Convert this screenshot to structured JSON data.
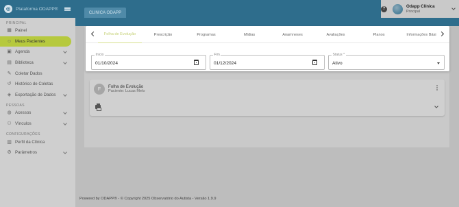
{
  "sidebar": {
    "app_title": "Plataforma ODAPP®",
    "logo_glyph": "◎",
    "sections": {
      "principal": "PRINCIPAL",
      "pessoas": "PESSOAS",
      "configuracoes": "CONFIGURAÇÕES"
    },
    "items": {
      "painel": {
        "label": "Painel",
        "icon": "dashboard-icon"
      },
      "meus_pacientes": {
        "label": "Meus Pacientes",
        "icon": "patients-icon"
      },
      "agenda": {
        "label": "Agenda",
        "icon": "calendar-icon"
      },
      "biblioteca": {
        "label": "Biblioteca",
        "icon": "library-icon"
      },
      "coletar_dados": {
        "label": "Coletar Dados",
        "icon": "pencil-icon"
      },
      "historico_coletas": {
        "label": "Histórico de Coletas",
        "icon": "history-icon"
      },
      "exportacao": {
        "label": "Exportação de Dados",
        "icon": "export-icon"
      },
      "acessos": {
        "label": "Acessos",
        "icon": "globe-icon"
      },
      "vinculos": {
        "label": "Vínculos",
        "icon": "link-icon"
      },
      "perfil_clinica": {
        "label": "Perfil da Clínica",
        "icon": "building-icon"
      },
      "parametros": {
        "label": "Parâmetros",
        "icon": "settings-icon"
      }
    },
    "active_color": "#b6c93e"
  },
  "header": {
    "clinic_tab": "CLINICA ODAPP",
    "help_glyph": "?",
    "user_name": "Odapp Clínica",
    "user_role": "Principal",
    "brand_color": "#2e6d8c"
  },
  "tabs": {
    "items": [
      {
        "label": "Folha de Evolução",
        "active": true
      },
      {
        "label": "Prescrição"
      },
      {
        "label": "Programas"
      },
      {
        "label": "Mídias"
      },
      {
        "label": "Anamneses"
      },
      {
        "label": "Avaliações"
      },
      {
        "label": "Planos"
      },
      {
        "label": "Informações Bási"
      }
    ],
    "active_color": "#c3cf70"
  },
  "filters": {
    "inicio": {
      "label": "Início",
      "value": "01/10/2024"
    },
    "fim": {
      "label": "Fim",
      "value": "01/12/2024"
    },
    "status": {
      "label": "Status *",
      "value": "Ativo"
    }
  },
  "sheet": {
    "avatar_letter": "F",
    "title": "Folha de Evolução",
    "subtitle": "Paciente: Lucas Melo"
  },
  "footer": {
    "text": "Powered by ODAPP® - © Copyright 2025 Observatório do Autista - Versão 1.9.9"
  }
}
